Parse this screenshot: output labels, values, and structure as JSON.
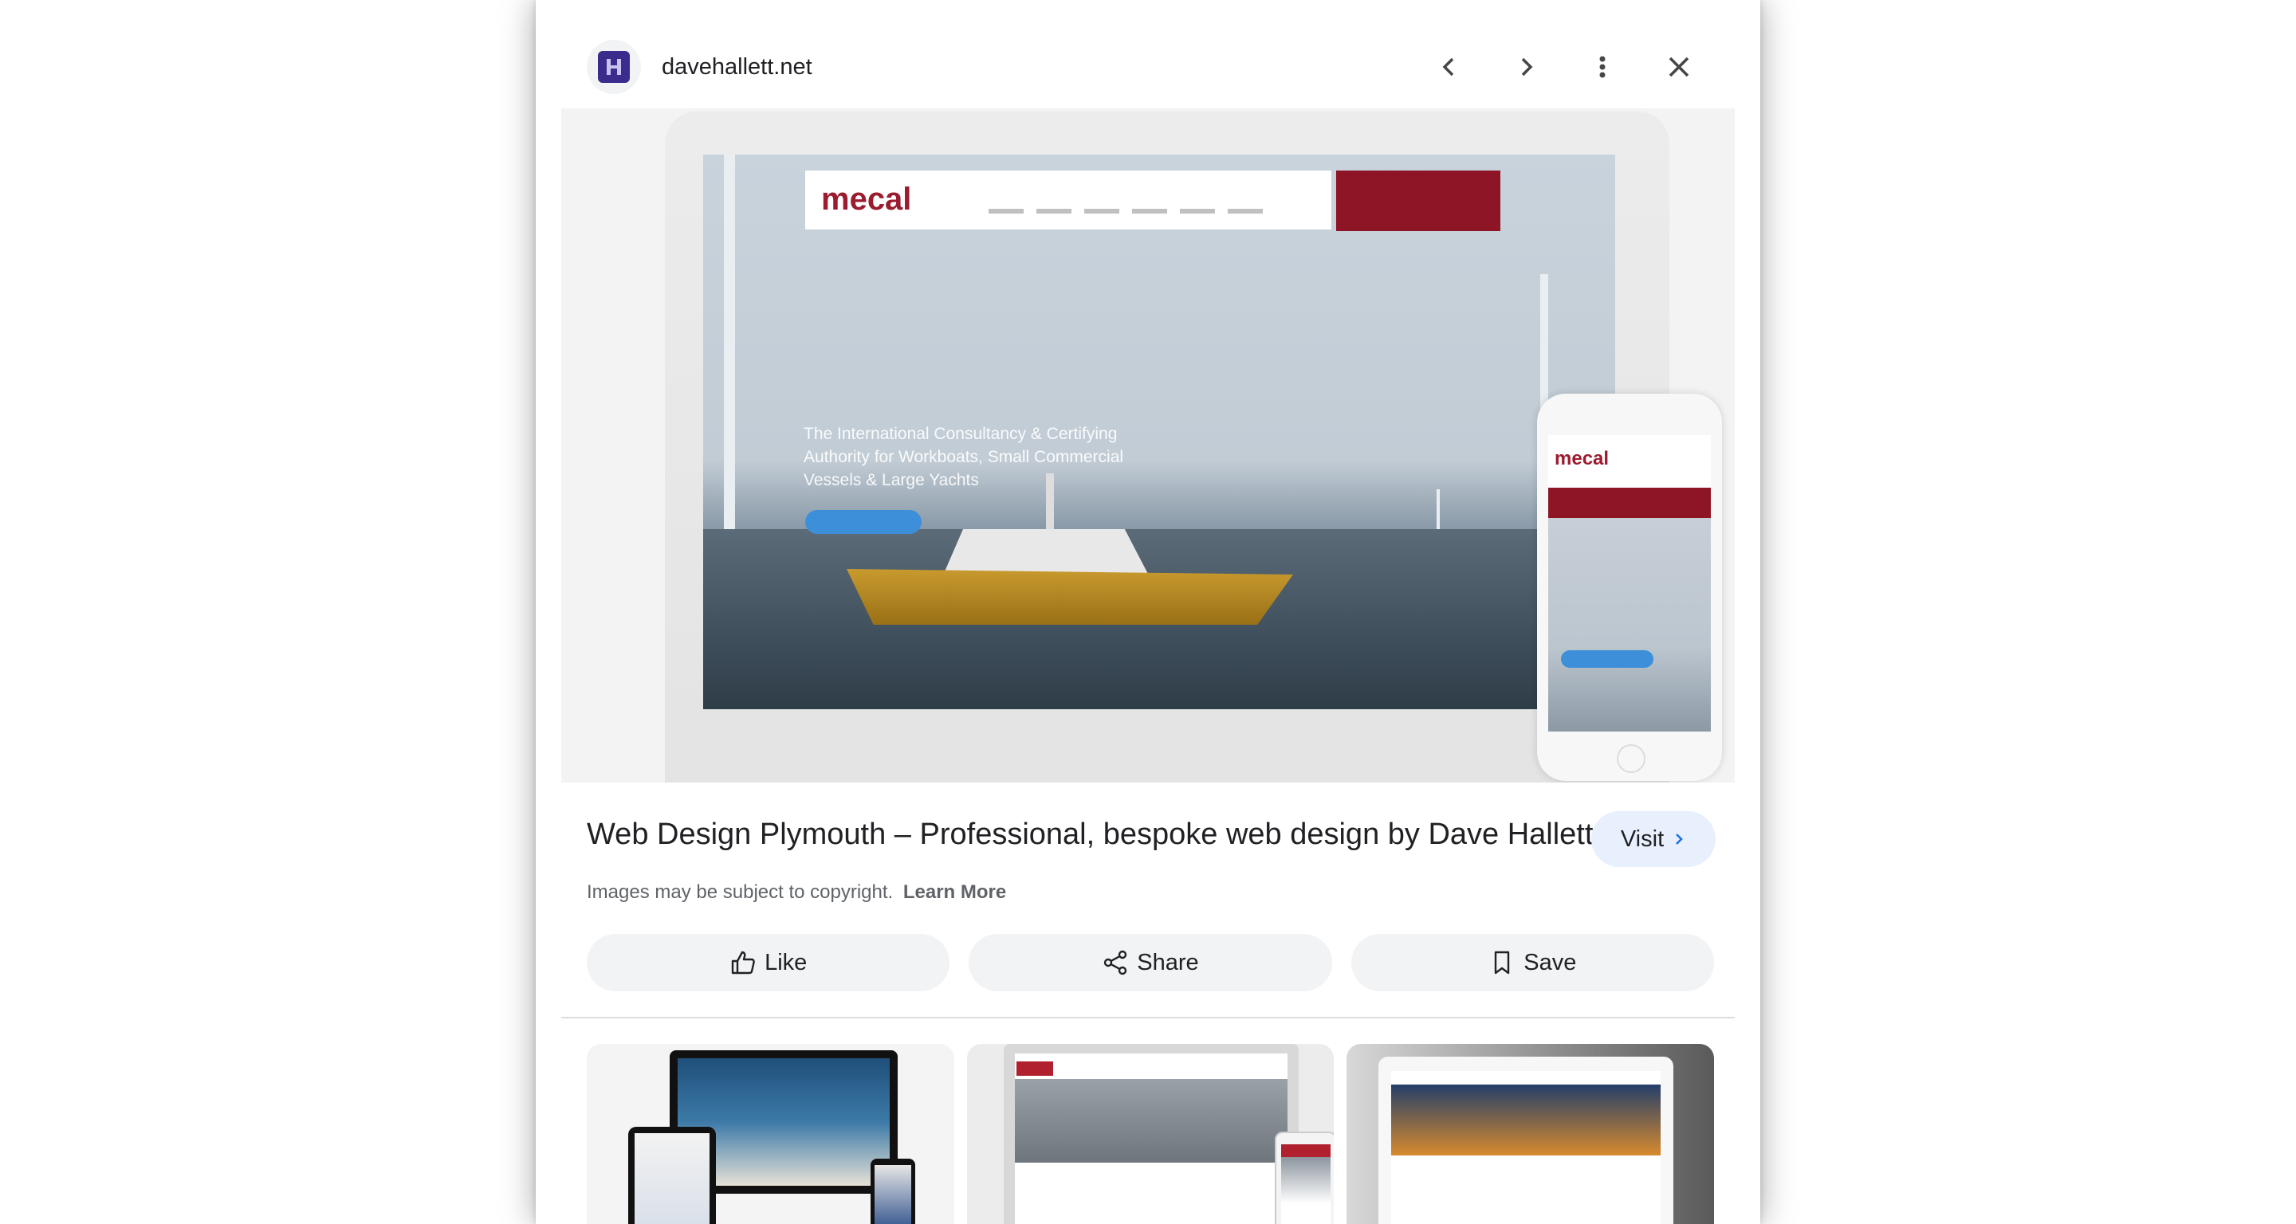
{
  "header": {
    "favicon_letter": "H",
    "site_name": "davehallett.net",
    "icons": [
      "chevron-left-icon",
      "chevron-right-icon",
      "more-vert-icon",
      "close-icon"
    ]
  },
  "hero": {
    "site_logo": "mecal",
    "headline": "The International Consultancy & Certifying Authority for Workboats, Small Commercial Vessels & Large Yachts",
    "phone_logo": "mecal"
  },
  "result": {
    "title": "Web Design Plymouth – Professional, bespoke web design by Dave Hallett",
    "visit_label": "Visit",
    "copyright_text": "Images may be subject to copyright.",
    "learn_more_label": "Learn More"
  },
  "actions": {
    "like_label": "Like",
    "share_label": "Share",
    "save_label": "Save"
  },
  "colors": {
    "accent_bg": "#e8f0fe",
    "button_bg": "#f1f3f4",
    "brand_red": "#8e1526",
    "favicon_bg": "#3a2b8c"
  }
}
